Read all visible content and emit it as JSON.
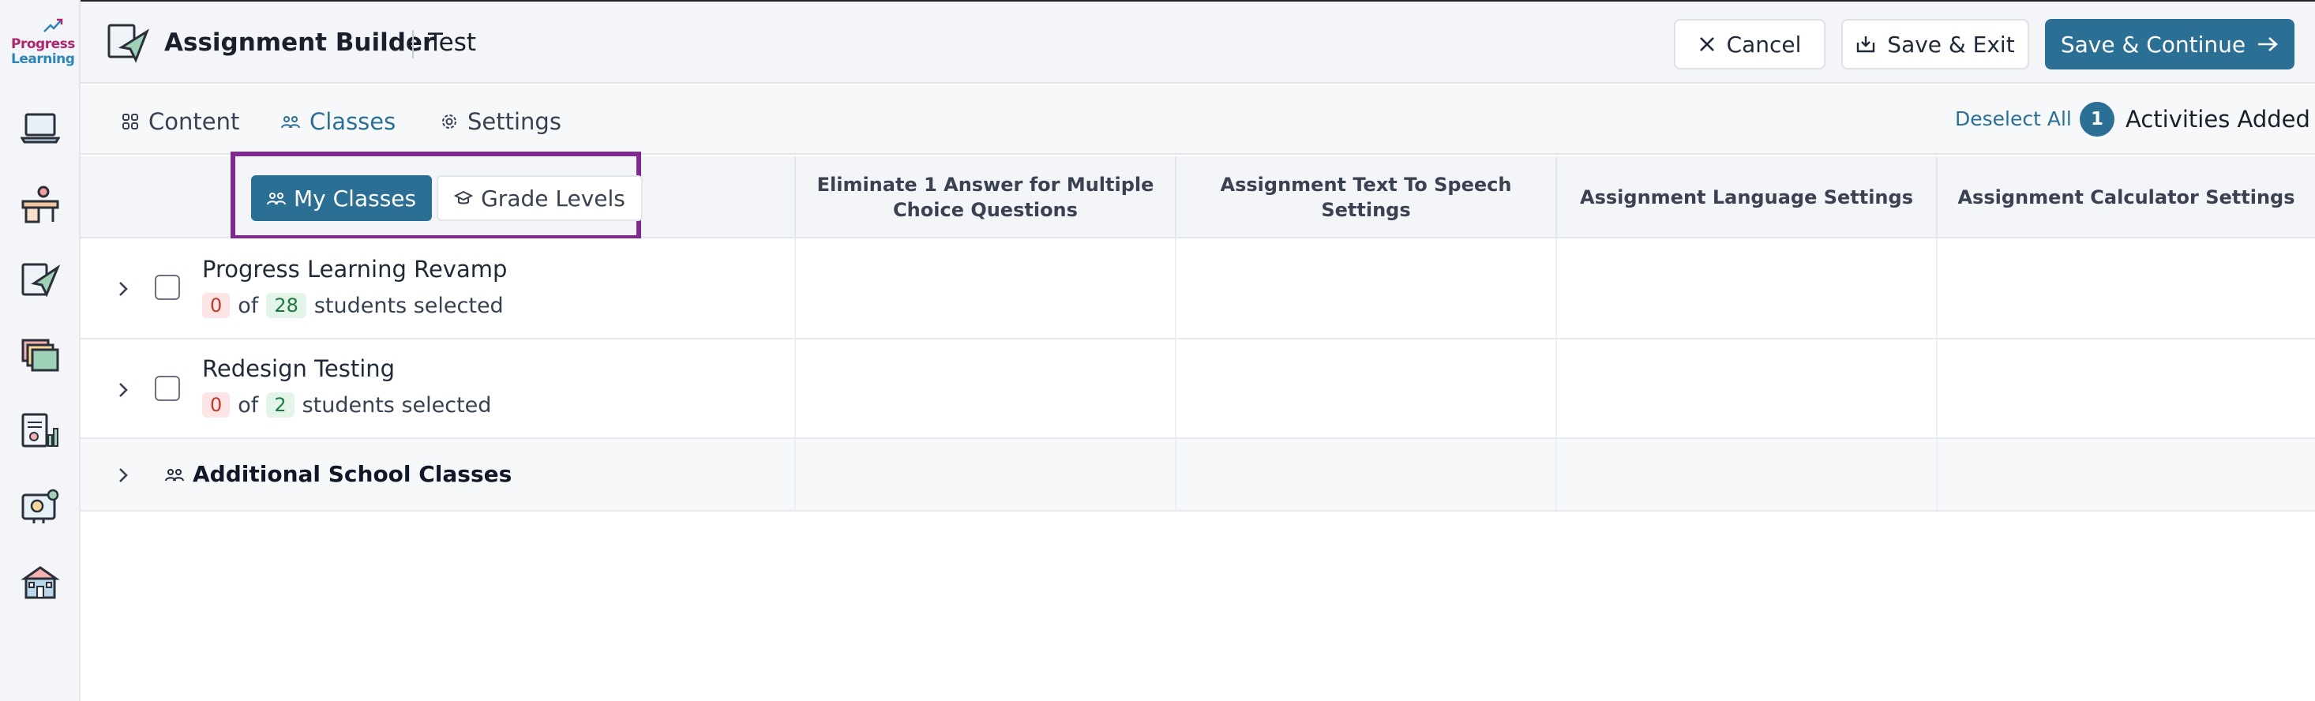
{
  "colors": {
    "primary": "#2b6f95",
    "highlight": "#7e2a8c",
    "danger_bg": "#fde5e5",
    "success_bg": "#e3f5e9"
  },
  "brand": {
    "line1": "Progress",
    "line2": "Learning"
  },
  "sidebar": {
    "items": [
      {
        "icon": "laptop-icon"
      },
      {
        "icon": "desk-icon"
      },
      {
        "icon": "assignment-plane-icon"
      },
      {
        "icon": "folders-icon"
      },
      {
        "icon": "report-chart-icon"
      },
      {
        "icon": "lightbulb-board-icon"
      },
      {
        "icon": "school-building-icon"
      }
    ]
  },
  "header": {
    "title": "Assignment Builder",
    "subtitle": "Test",
    "cancel_label": "Cancel",
    "save_exit_label": "Save & Exit",
    "save_continue_label": "Save & Continue"
  },
  "tabs": [
    {
      "label": "Content",
      "icon": "grid-icon",
      "active": false
    },
    {
      "label": "Classes",
      "icon": "people-icon",
      "active": true
    },
    {
      "label": "Settings",
      "icon": "gear-icon",
      "active": false
    }
  ],
  "toolbar": {
    "deselect_label": "Deselect All",
    "activities_count": "1",
    "activities_label": "Activities Added"
  },
  "segmented": {
    "my_classes": "My Classes",
    "grade_levels": "Grade Levels"
  },
  "columns": [
    "Eliminate 1 Answer for Multiple Choice Questions",
    "Assignment Text To Speech Settings",
    "Assignment Language Settings",
    "Assignment Calculator Settings"
  ],
  "rows": [
    {
      "title": "Progress Learning Revamp",
      "selected": "0",
      "of": "of",
      "total": "28",
      "suffix": "students selected"
    },
    {
      "title": "Redesign Testing",
      "selected": "0",
      "of": "of",
      "total": "2",
      "suffix": "students selected"
    }
  ],
  "additional": {
    "title": "Additional School Classes"
  }
}
